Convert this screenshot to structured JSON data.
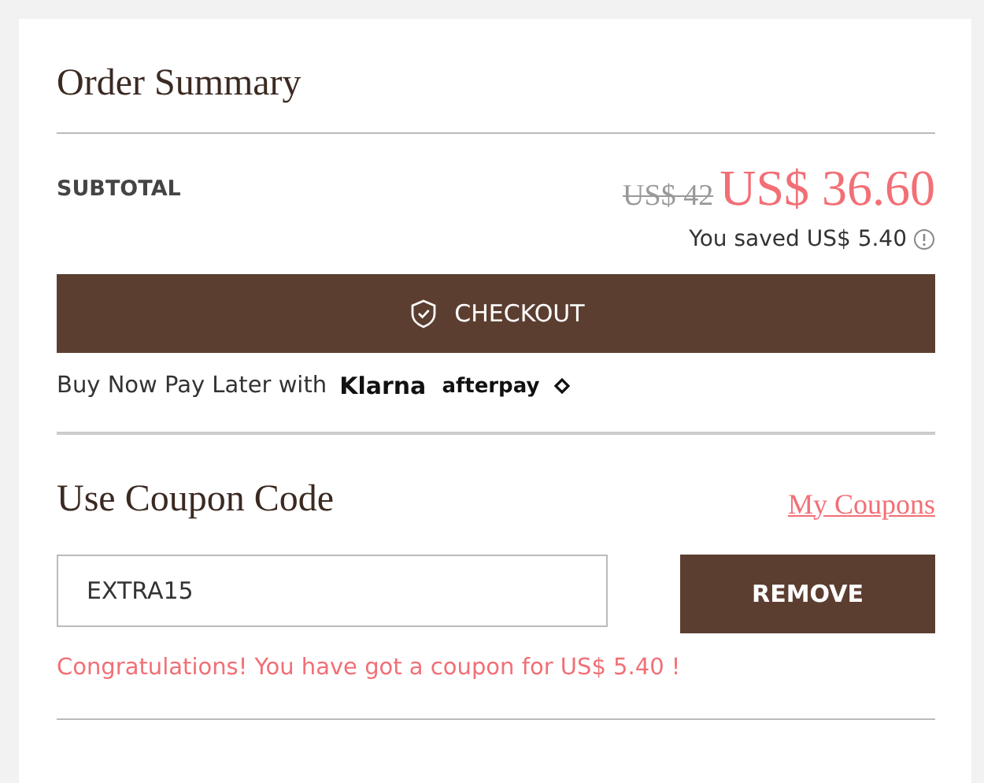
{
  "title": "Order Summary",
  "subtotal": {
    "label": "SUBTOTAL",
    "original_price": "US$ 42",
    "price": "US$ 36.60",
    "saved": "You saved US$ 5.40"
  },
  "checkout_button": {
    "label": "CHECKOUT"
  },
  "pay_later": {
    "text": "Buy Now Pay Later with",
    "providers": [
      "Klarna",
      "afterpay"
    ]
  },
  "coupon": {
    "title": "Use Coupon Code",
    "link": "My Coupons",
    "value": "EXTRA15",
    "button": "REMOVE",
    "message": "Congratulations! You have got a coupon for US$ 5.40 !"
  }
}
